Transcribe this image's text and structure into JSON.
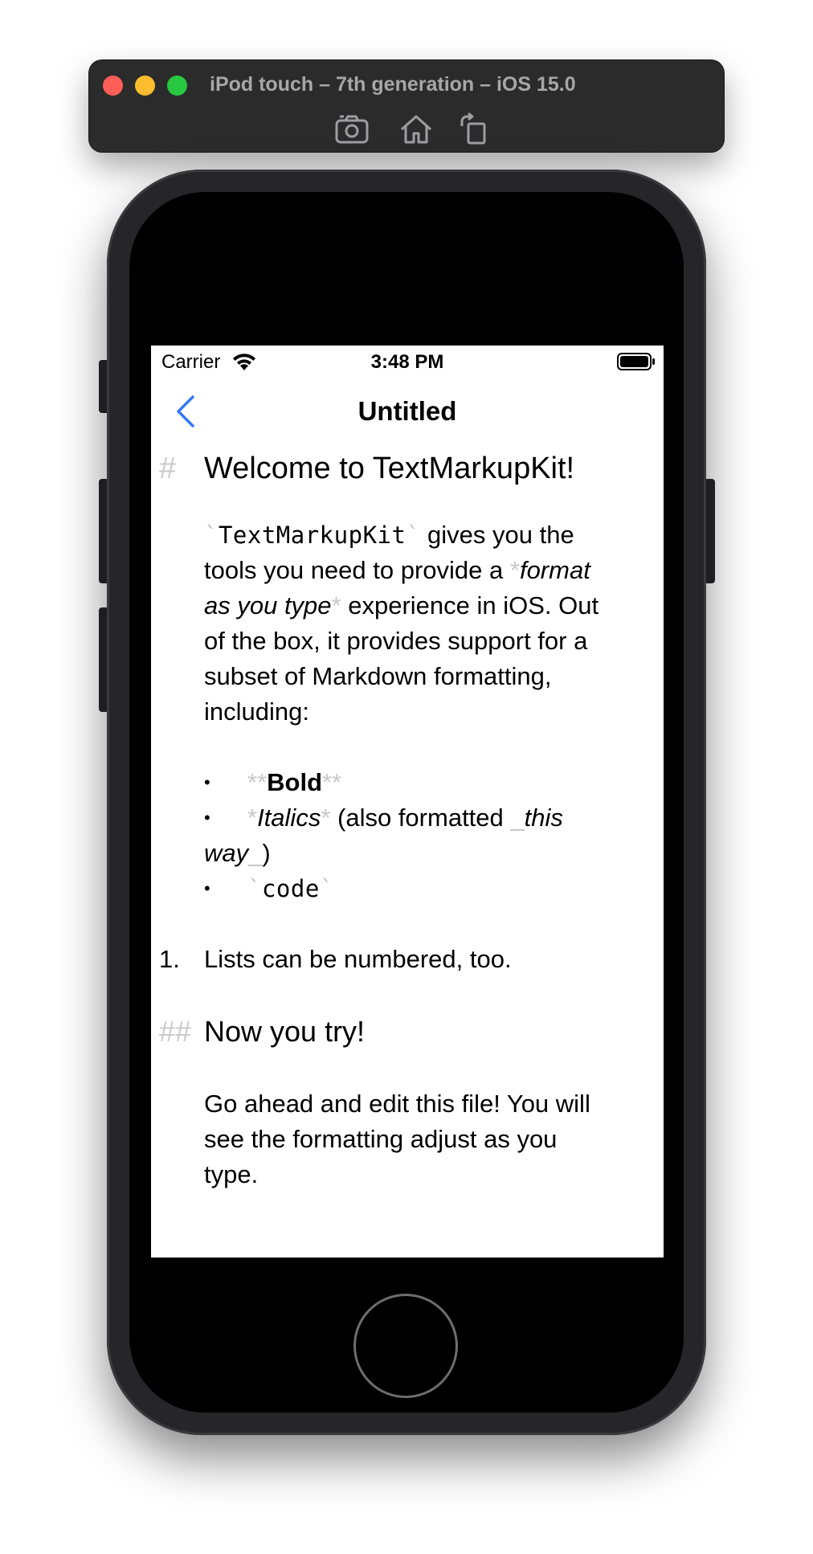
{
  "simulator": {
    "title": "iPod touch – 7th generation – iOS 15.0",
    "tools": [
      "screenshot-icon",
      "home-icon",
      "rotate-icon"
    ]
  },
  "status_bar": {
    "carrier": "Carrier",
    "time": "3:48 PM"
  },
  "nav": {
    "title": "Untitled",
    "back_color": "#3478f6"
  },
  "document": {
    "h1_marker": "#",
    "h1_text": "Welcome to TextMarkupKit!",
    "para1": {
      "code_open": "`",
      "code_text": "TextMarkupKit",
      "code_close": "`",
      "t1": " gives you the",
      "t2": "tools you need to provide a ",
      "em_open": "*",
      "em_1": "format",
      "em_2": "as you type",
      "em_close": "*",
      "t3": " experience in iOS. Out",
      "t4": "of the box, it provides support for a",
      "t5": "subset of Markdown formatting,",
      "t6": "including:"
    },
    "bullets": {
      "dot": "•",
      "b1_open": "**",
      "b1_text": "Bold",
      "b1_close": "**",
      "b2_open": "*",
      "b2_text": "Italics",
      "b2_close": "*",
      "b2_rest": " (also formatted ",
      "b2_u_open": "_",
      "b2_u_text1": "this",
      "b2_u_text2": "way",
      "b2_u_close": "_",
      "b2_end": ")",
      "b3_open": "`",
      "b3_text": "code",
      "b3_close": "`"
    },
    "numbered": {
      "marker": "1.",
      "text": "Lists can be numbered, too."
    },
    "h2_marker": "##",
    "h2_text": "Now you try!",
    "para2": {
      "l1": "Go ahead and edit this file! You will",
      "l2": "see the formatting adjust as you",
      "l3": "type."
    }
  }
}
